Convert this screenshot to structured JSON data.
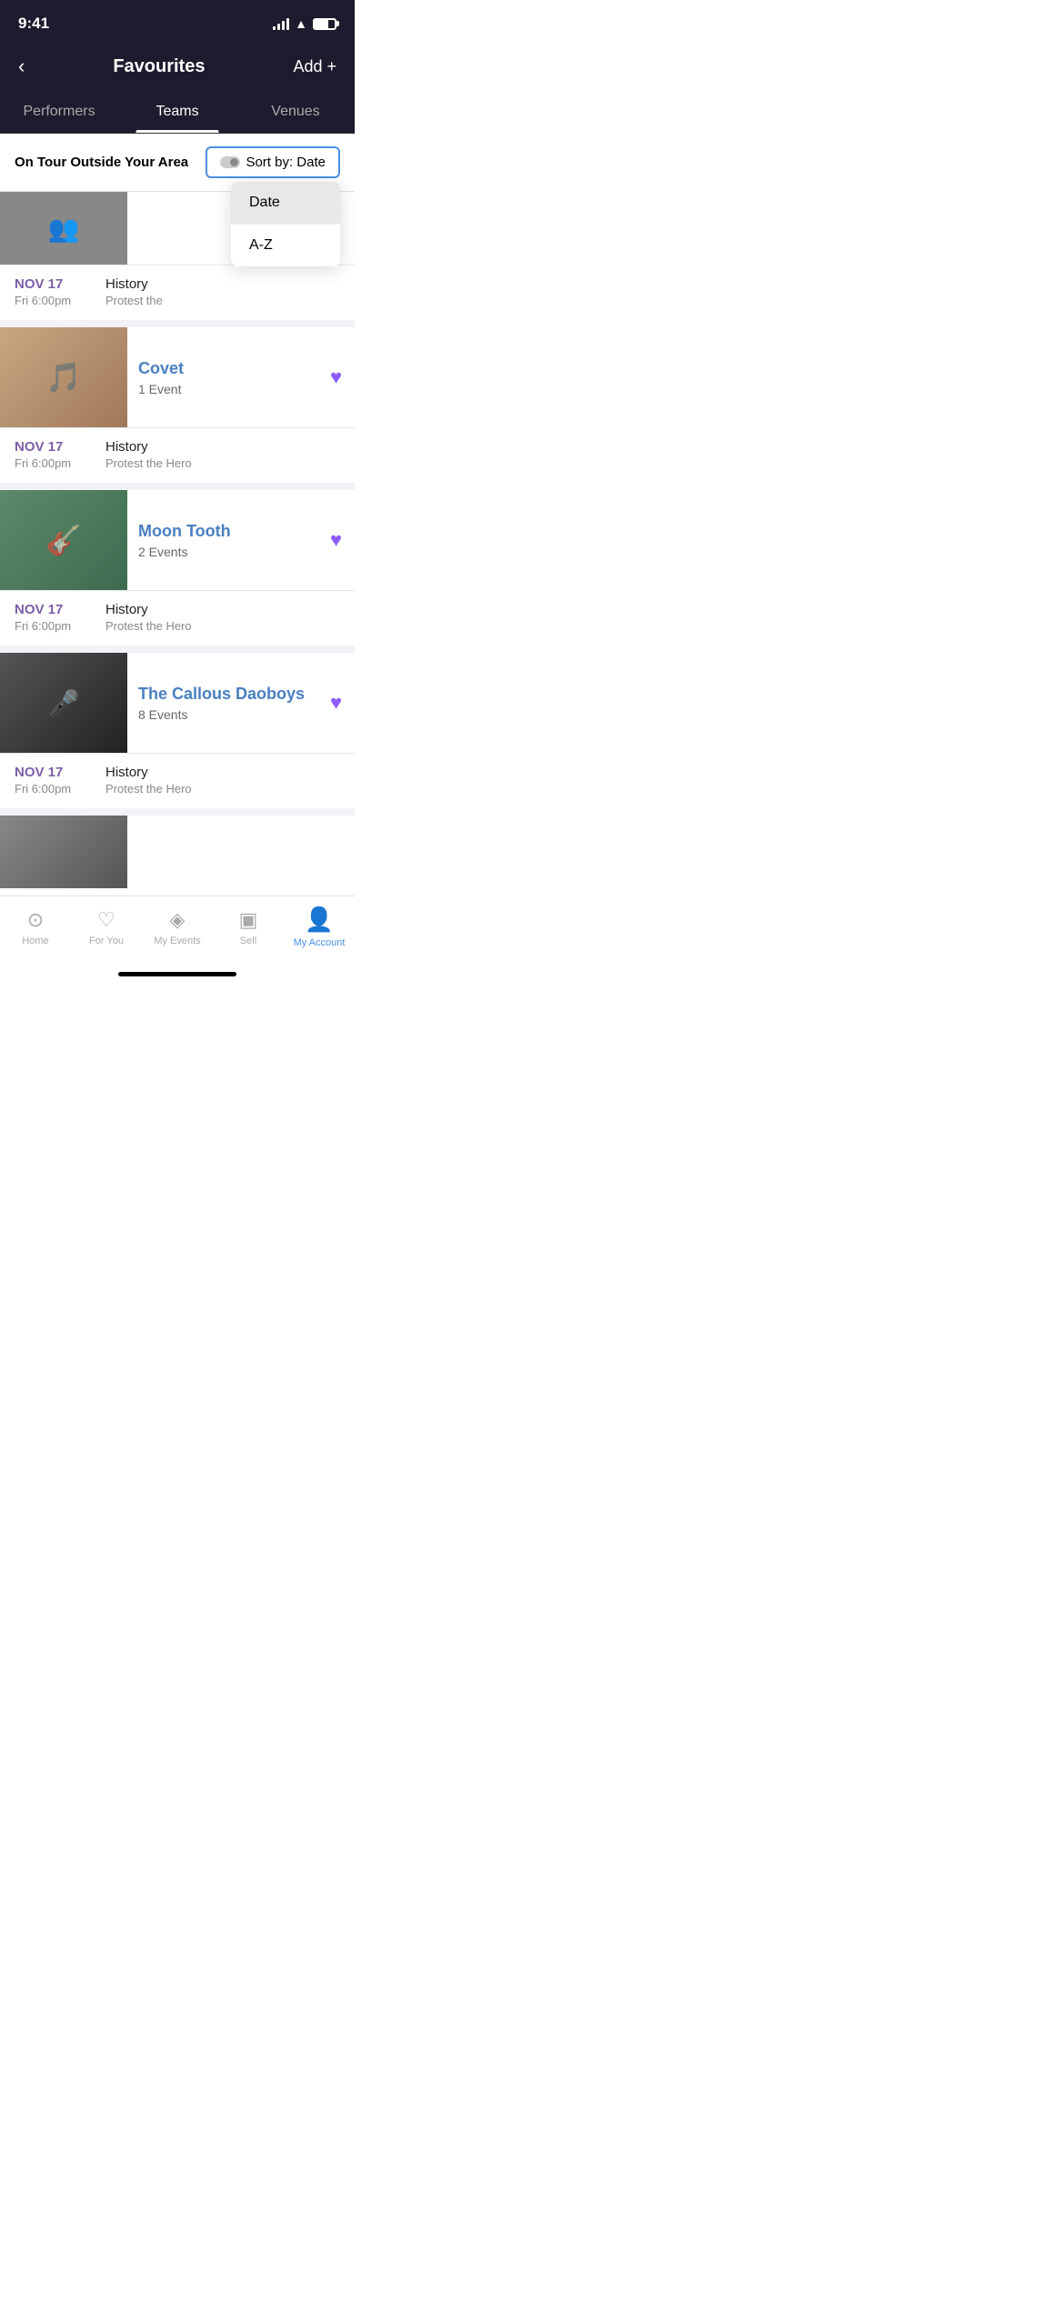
{
  "statusBar": {
    "time": "9:41"
  },
  "header": {
    "backLabel": "‹",
    "title": "Favourites",
    "addLabel": "Add +"
  },
  "tabs": [
    {
      "label": "Performers",
      "active": false
    },
    {
      "label": "Teams",
      "active": true
    },
    {
      "label": "Venues",
      "active": false
    }
  ],
  "sortBar": {
    "sectionLabel": "On Tour Outside Your Area",
    "sortButtonLabel": "Sort by: Date"
  },
  "dropdown": {
    "items": [
      {
        "label": "Date",
        "selected": true
      },
      {
        "label": "A-Z",
        "selected": false
      }
    ]
  },
  "performers": [
    {
      "name": "Covet",
      "events": "1 Event",
      "eventDate": "NOV 17",
      "eventTime": "Fri 6:00pm",
      "venue": "History",
      "support": "Protest the Hero",
      "favorited": true,
      "imgClass": "img-covet"
    },
    {
      "name": "Moon Tooth",
      "events": "2 Events",
      "eventDate": "NOV 17",
      "eventTime": "Fri 6:00pm",
      "venue": "History",
      "support": "Protest the Hero",
      "favorited": true,
      "imgClass": "img-moontooth"
    },
    {
      "name": "The Callous Daoboys",
      "events": "8 Events",
      "eventDate": "NOV 17",
      "eventTime": "Fri 6:00pm",
      "venue": "History",
      "support": "Protest the Hero",
      "favorited": true,
      "imgClass": "img-callous"
    }
  ],
  "bottomNav": [
    {
      "label": "Home",
      "icon": "⊙",
      "active": false
    },
    {
      "label": "For You",
      "icon": "♡",
      "active": false
    },
    {
      "label": "My Events",
      "icon": "◈",
      "active": false
    },
    {
      "label": "Sell",
      "icon": "▣",
      "active": false
    },
    {
      "label": "My Account",
      "icon": "👤",
      "active": true
    }
  ]
}
